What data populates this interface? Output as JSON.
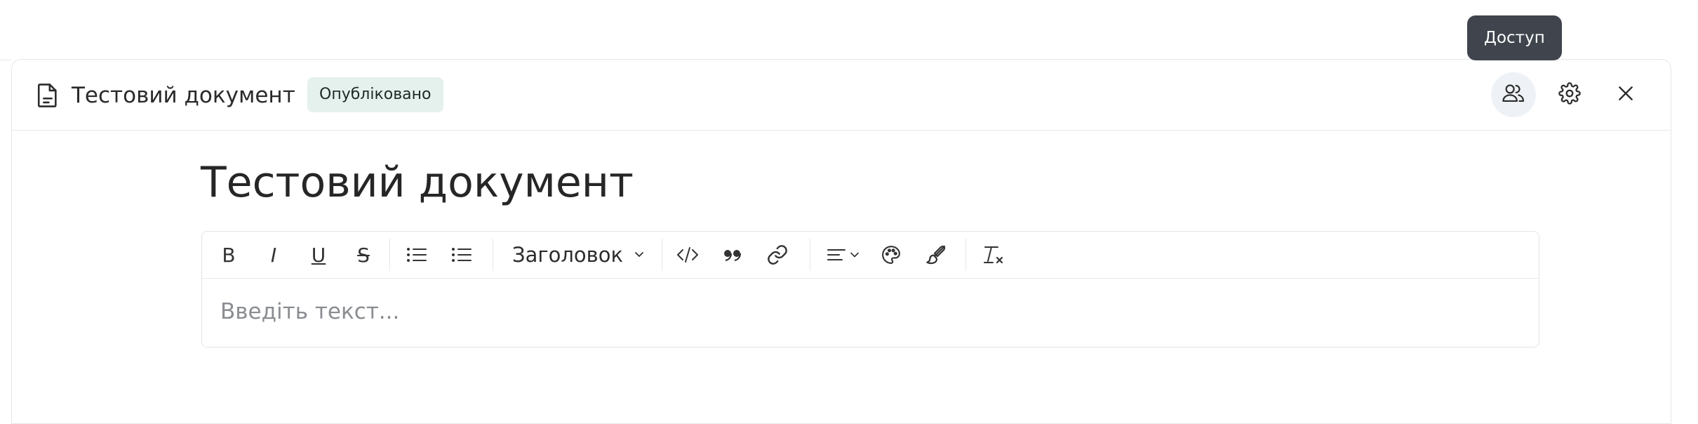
{
  "header": {
    "title": "Тестовий документ",
    "status": "Опубліковано",
    "icons": {
      "document": "document-icon",
      "access": "users-icon",
      "settings": "gear-icon",
      "close": "close-icon"
    }
  },
  "tooltip": {
    "text": "Доступ"
  },
  "document": {
    "title": "Тестовий документ"
  },
  "toolbar": {
    "bold": "B",
    "italic": "I",
    "underline": "U",
    "strikethrough": "S",
    "heading": "Заголовок",
    "icons": [
      "bullet-list-icon",
      "numbered-list-icon",
      "code-icon",
      "quote-icon",
      "link-icon",
      "align-icon",
      "palette-icon",
      "brush-icon",
      "clear-format-icon"
    ]
  },
  "editor": {
    "placeholder": "Введіть текст..."
  },
  "colors": {
    "badge_bg": "#e4f1ec",
    "tooltip_bg": "#3f444d",
    "active_button_bg": "#eef2f6"
  }
}
